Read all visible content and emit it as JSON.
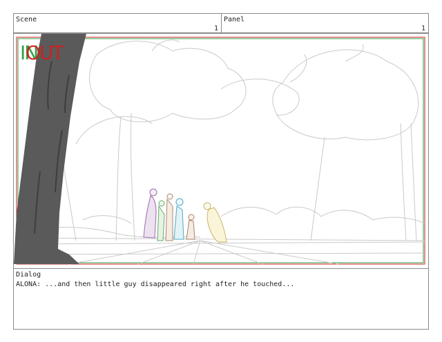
{
  "scene": {
    "label": "Scene",
    "number": "1"
  },
  "panel": {
    "label": "Panel",
    "number": "1"
  },
  "frame": {
    "in_text": "IN",
    "out_text": "OUT",
    "in_color": "#2ea043",
    "out_color": "#d21f1f"
  },
  "dialog": {
    "label": "Dialog",
    "line": "ALONA: ...and then little guy disappeared right after he touched..."
  }
}
